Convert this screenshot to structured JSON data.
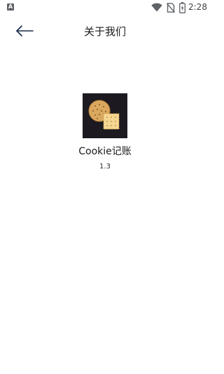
{
  "status_bar": {
    "left_icon_letter": "A",
    "wifi_icon": "wifi-icon",
    "no_sim_icon": "no-sim-icon",
    "battery_icon": "battery-icon",
    "time": "2:28"
  },
  "header": {
    "back_icon": "arrow-left-icon",
    "title": "关于我们"
  },
  "app": {
    "logo_icon": "cookie-cracker-logo",
    "name": "Cookie记账",
    "version": "1.3"
  },
  "colors": {
    "background": "#ffffff",
    "text": "#1b1b1b",
    "back_arrow": "#1a2a4a",
    "logo_background": "#1c1a20",
    "cookie_round": "#d9a75e",
    "cookie_square": "#f6d792"
  }
}
